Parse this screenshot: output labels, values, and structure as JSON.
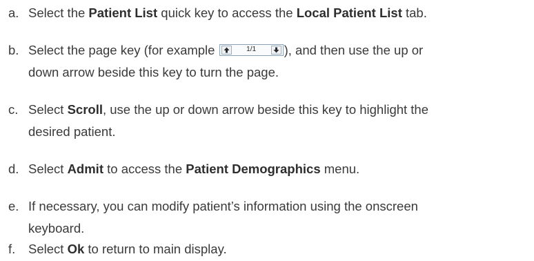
{
  "steps": [
    {
      "marker": "a.",
      "parts": [
        {
          "t": "Select the "
        },
        {
          "t": "Patient List",
          "b": true
        },
        {
          "t": " quick key to access the "
        },
        {
          "t": "Local Patient List",
          "b": true
        },
        {
          "t": " tab."
        }
      ]
    },
    {
      "marker": "b.",
      "lines": [
        "Select the page key (for example ",
        "), and then use the up or",
        "down arrow beside this key to turn the page."
      ],
      "page_key": {
        "value": "1/1",
        "up_icon": "arrow-up-icon",
        "down_icon": "arrow-down-icon"
      }
    },
    {
      "marker": "c.",
      "lines": [
        [
          {
            "t": "Select "
          },
          {
            "t": "Scroll",
            "b": true
          },
          {
            "t": ", use the up or down arrow beside this key to highlight the"
          }
        ],
        [
          {
            "t": "desired patient."
          }
        ]
      ]
    },
    {
      "marker": "d.",
      "parts": [
        {
          "t": "Select "
        },
        {
          "t": "Admit",
          "b": true
        },
        {
          "t": " to access the "
        },
        {
          "t": "Patient Demographics",
          "b": true
        },
        {
          "t": " menu."
        }
      ]
    },
    {
      "marker": "e.",
      "lines": [
        "If necessary, you can modify patient’s information using the onscreen",
        "keyboard."
      ]
    },
    {
      "marker": "f.",
      "parts": [
        {
          "t": "Select "
        },
        {
          "t": "Ok",
          "b": true
        },
        {
          "t": " to return to main display."
        }
      ]
    }
  ]
}
